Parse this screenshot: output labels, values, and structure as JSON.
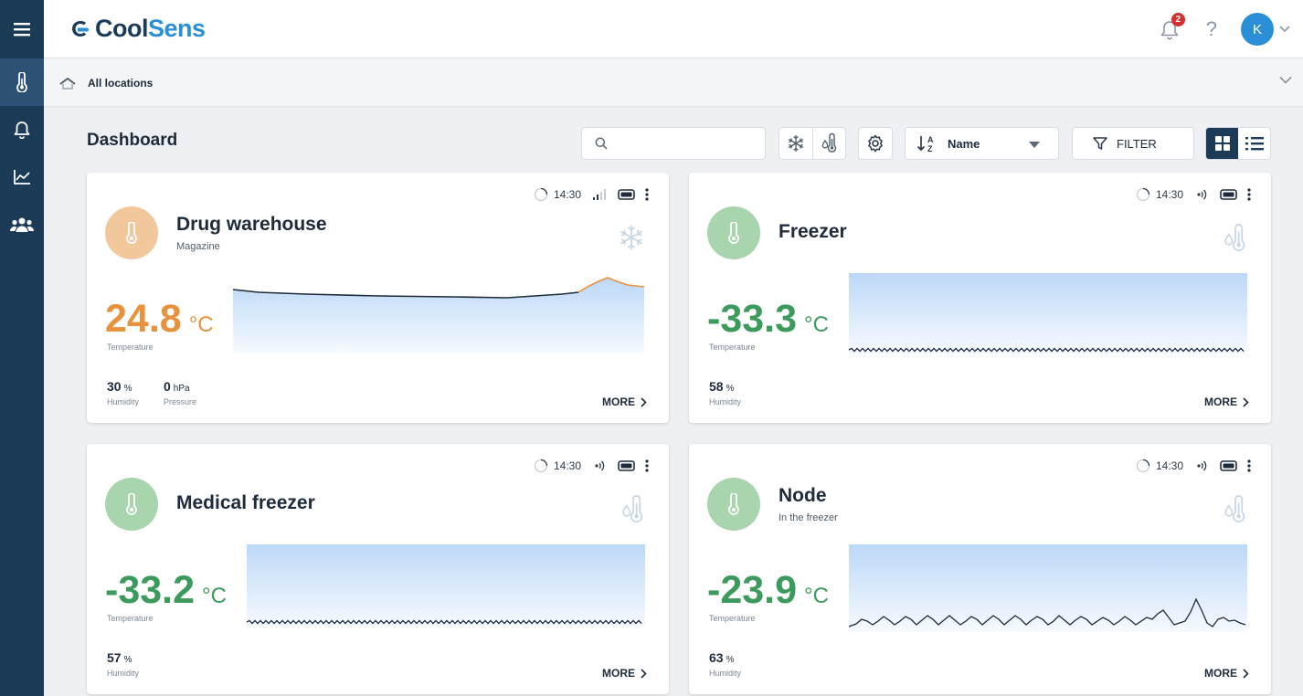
{
  "app": {
    "logo_part1": "Cool",
    "logo_part2": "Sens"
  },
  "header": {
    "notification_count": "2",
    "help_label": "?",
    "user_initial": "K"
  },
  "breadcrumb": {
    "label": "All locations"
  },
  "page": {
    "title": "Dashboard"
  },
  "toolbar": {
    "search_value": "",
    "sort_label": "Name",
    "filter_label": "FILTER"
  },
  "colors": {
    "sidebar": "#1c3b57",
    "accent": "#2a8fd6",
    "orange": "#e8923e",
    "green": "#3c9a5c",
    "warm_circle": "#f3c79c",
    "cool_circle": "#a8d4ae"
  },
  "cards": [
    {
      "title": "Drug warehouse",
      "subtitle": "Magazine",
      "time": "14:30",
      "signal_icon": "cellular-signal-icon",
      "type_icon": "snowflake-icon",
      "temperature": "24.8",
      "temp_unit": "°C",
      "temp_label": "Temperature",
      "temp_color": "#e8923e",
      "metrics": [
        {
          "value": "30",
          "unit": "%",
          "label": "Humidity"
        },
        {
          "value": "0",
          "unit": "hPa",
          "label": "Pressure"
        }
      ],
      "more": "MORE"
    },
    {
      "title": "Freezer",
      "subtitle": "",
      "time": "14:30",
      "signal_icon": "radio-signal-icon",
      "type_icon": "humidity-thermometer-icon",
      "temperature": "-33.3",
      "temp_unit": "°C",
      "temp_label": "Temperature",
      "temp_color": "#3c9a5c",
      "metrics": [
        {
          "value": "58",
          "unit": "%",
          "label": "Humidity"
        }
      ],
      "more": "MORE"
    },
    {
      "title": "Medical freezer",
      "subtitle": "",
      "time": "14:30",
      "signal_icon": "radio-signal-icon",
      "type_icon": "humidity-thermometer-icon",
      "temperature": "-33.2",
      "temp_unit": "°C",
      "temp_label": "Temperature",
      "temp_color": "#3c9a5c",
      "metrics": [
        {
          "value": "57",
          "unit": "%",
          "label": "Humidity"
        }
      ],
      "more": "MORE"
    },
    {
      "title": "Node",
      "subtitle": "In the freezer",
      "time": "14:30",
      "signal_icon": "radio-signal-icon",
      "type_icon": "humidity-thermometer-icon",
      "temperature": "-23.9",
      "temp_unit": "°C",
      "temp_label": "Temperature",
      "temp_color": "#3c9a5c",
      "metrics": [
        {
          "value": "63",
          "unit": "%",
          "label": "Humidity"
        }
      ],
      "more": "MORE"
    }
  ]
}
